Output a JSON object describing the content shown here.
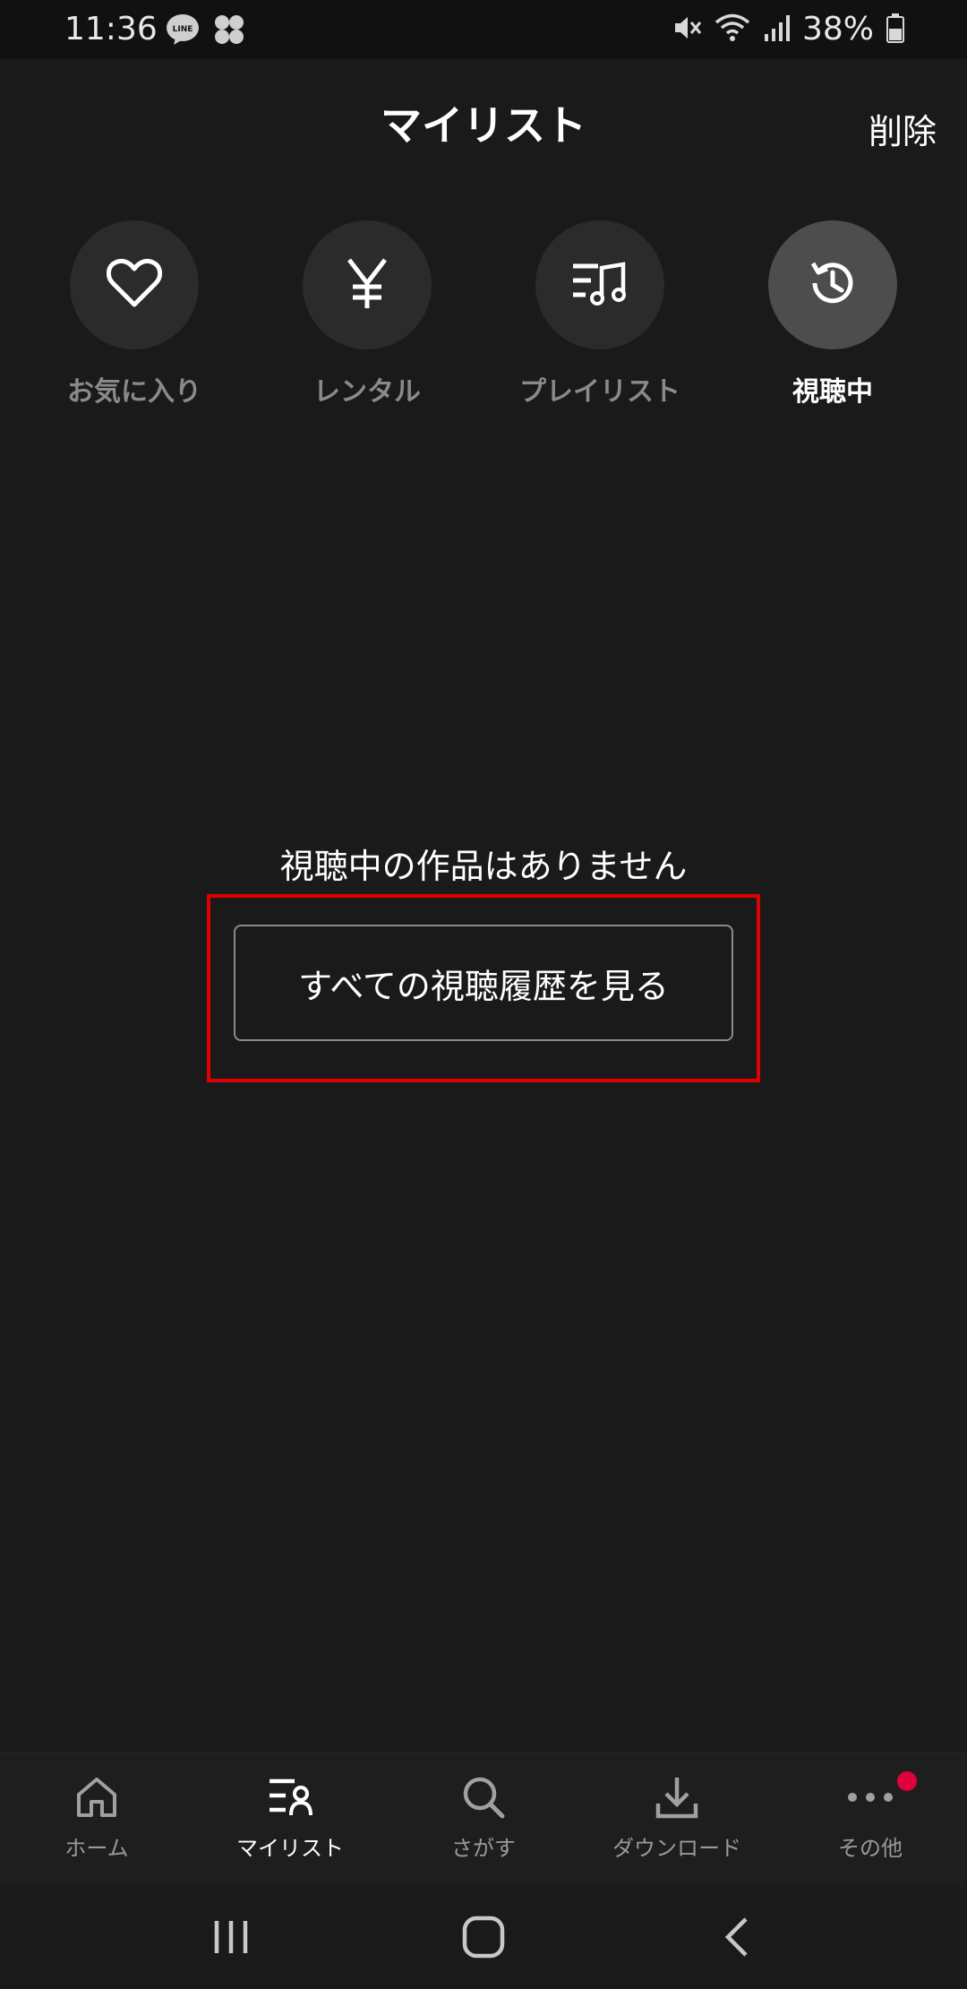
{
  "status_bar": {
    "time": "11:36",
    "battery": "38%"
  },
  "header": {
    "title": "マイリスト",
    "delete_label": "削除"
  },
  "categories": [
    {
      "label": "お気に入り",
      "icon": "heart-icon",
      "active": false
    },
    {
      "label": "レンタル",
      "icon": "yen-icon",
      "active": false
    },
    {
      "label": "プレイリスト",
      "icon": "playlist-icon",
      "active": false
    },
    {
      "label": "視聴中",
      "icon": "history-icon",
      "active": true
    }
  ],
  "empty_state": {
    "message": "視聴中の作品はありません",
    "button_label": "すべての視聴履歴を見る"
  },
  "bottom_nav": [
    {
      "label": "ホーム",
      "icon": "home-icon",
      "active": false
    },
    {
      "label": "マイリスト",
      "icon": "mylist-icon",
      "active": true
    },
    {
      "label": "さがす",
      "icon": "search-icon",
      "active": false
    },
    {
      "label": "ダウンロード",
      "icon": "download-icon",
      "active": false
    },
    {
      "label": "その他",
      "icon": "more-icon",
      "active": false
    }
  ],
  "colors": {
    "background": "#1a1a1a",
    "highlight": "#e00000",
    "badge": "#e0003c",
    "inactive_text": "#8a8a8a"
  }
}
